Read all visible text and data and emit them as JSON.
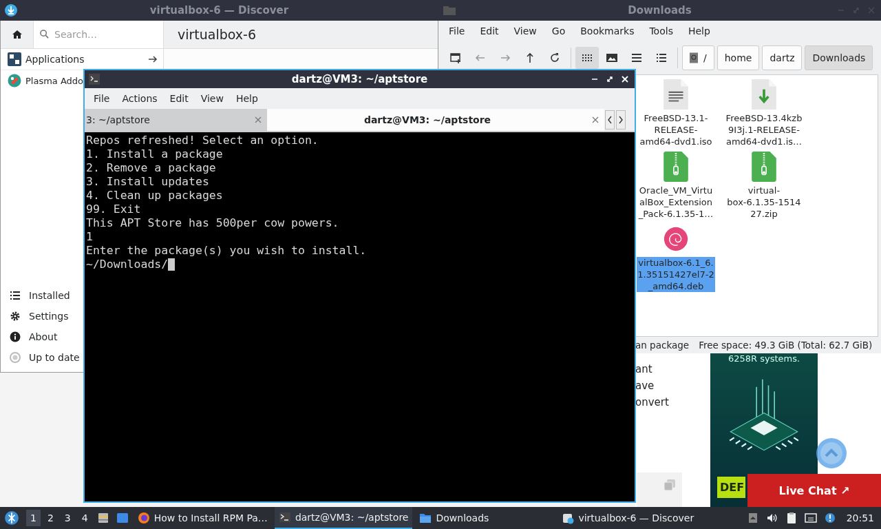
{
  "discover": {
    "title": "virtualbox-6 — Discover",
    "search": {
      "placeholder": "Search…"
    },
    "heading": "virtualbox-6",
    "categories": [
      {
        "label": "Applications",
        "kind": "applications"
      },
      {
        "label": "Plasma Addo",
        "kind": "addons"
      }
    ],
    "nav": [
      {
        "label": "Installed",
        "kind": "installed"
      },
      {
        "label": "Settings",
        "kind": "settings"
      },
      {
        "label": "About",
        "kind": "about"
      },
      {
        "label": "Up to date",
        "kind": "updates"
      }
    ]
  },
  "file_manager": {
    "title": "Downloads",
    "menu": [
      "File",
      "Edit",
      "View",
      "Go",
      "Bookmarks",
      "Tools",
      "Help"
    ],
    "view_modes": [
      {
        "kind": "icons",
        "selected": true
      },
      {
        "kind": "thumbnails",
        "selected": false
      },
      {
        "kind": "compact",
        "selected": false
      },
      {
        "kind": "details",
        "selected": false
      }
    ],
    "path": [
      {
        "label": "/",
        "selected": false
      },
      {
        "label": "home",
        "selected": false
      },
      {
        "label": "dartz",
        "selected": false
      },
      {
        "label": "Downloads",
        "selected": true
      }
    ],
    "files": [
      {
        "name": "FreeBSD-13.1-\nRELEASE-\namd64-dvd1.iso",
        "kind": "text",
        "selected": false
      },
      {
        "name": "FreeBSD-13.4kzb\n9I3j.1-RELEASE-\namd64-dvd1.is…",
        "kind": "download",
        "selected": false
      },
      {
        "name": "Oracle_VM_Virtu\nalBox_Extension\n_Pack-6.1.35-1…",
        "kind": "archive",
        "selected": false
      },
      {
        "name": "virtual-\nbox-6.1.35-1514\n27.zip",
        "kind": "archive",
        "selected": false
      },
      {
        "name": "virtualbox-6.1_6.\n1.35151427el7-2\n_amd64.deb",
        "kind": "debian",
        "selected": true
      }
    ],
    "status_left": "an package",
    "status_right": "Free space: 49.3 GiB (Total: 62.7 GiB)"
  },
  "web_page": {
    "snippets": [
      "ant",
      "ave",
      "onvert"
    ],
    "ad_text": "6258R systems.",
    "ad_button": "DEF",
    "live_chat": "Live Chat ↗"
  },
  "terminal": {
    "title": "dartz@VM3: ~/aptstore",
    "menu": [
      "File",
      "Actions",
      "Edit",
      "View",
      "Help"
    ],
    "tabs": [
      {
        "label": "3: ~/aptstore",
        "selected": false
      },
      {
        "label": "dartz@VM3: ~/aptstore",
        "selected": true
      }
    ],
    "lines": [
      "Repos refreshed! Select an option.",
      "1. Install a package",
      "2. Remove a package",
      "3. Install updates",
      "4. Clean up packages",
      "99. Exit",
      "This APT Store has 500per cow powers.",
      "1",
      "Enter the package(s) you wish to install.",
      "~/Downloads/"
    ]
  },
  "taskbar": {
    "desktops": [
      {
        "label": "1",
        "selected": true
      },
      {
        "label": "2",
        "selected": false
      },
      {
        "label": "3",
        "selected": false
      },
      {
        "label": "4",
        "selected": false
      }
    ],
    "tasks": [
      {
        "label": "How to Install RPM Pa…",
        "kind": "browser",
        "selected": false
      },
      {
        "label": "dartz@VM3: ~/aptstore",
        "kind": "terminal",
        "selected": true
      },
      {
        "label": "Downloads",
        "kind": "folder",
        "selected": false
      },
      {
        "label": "virtualbox-6 — Discover",
        "kind": "discover",
        "selected": false
      }
    ],
    "clock": "20:51"
  }
}
